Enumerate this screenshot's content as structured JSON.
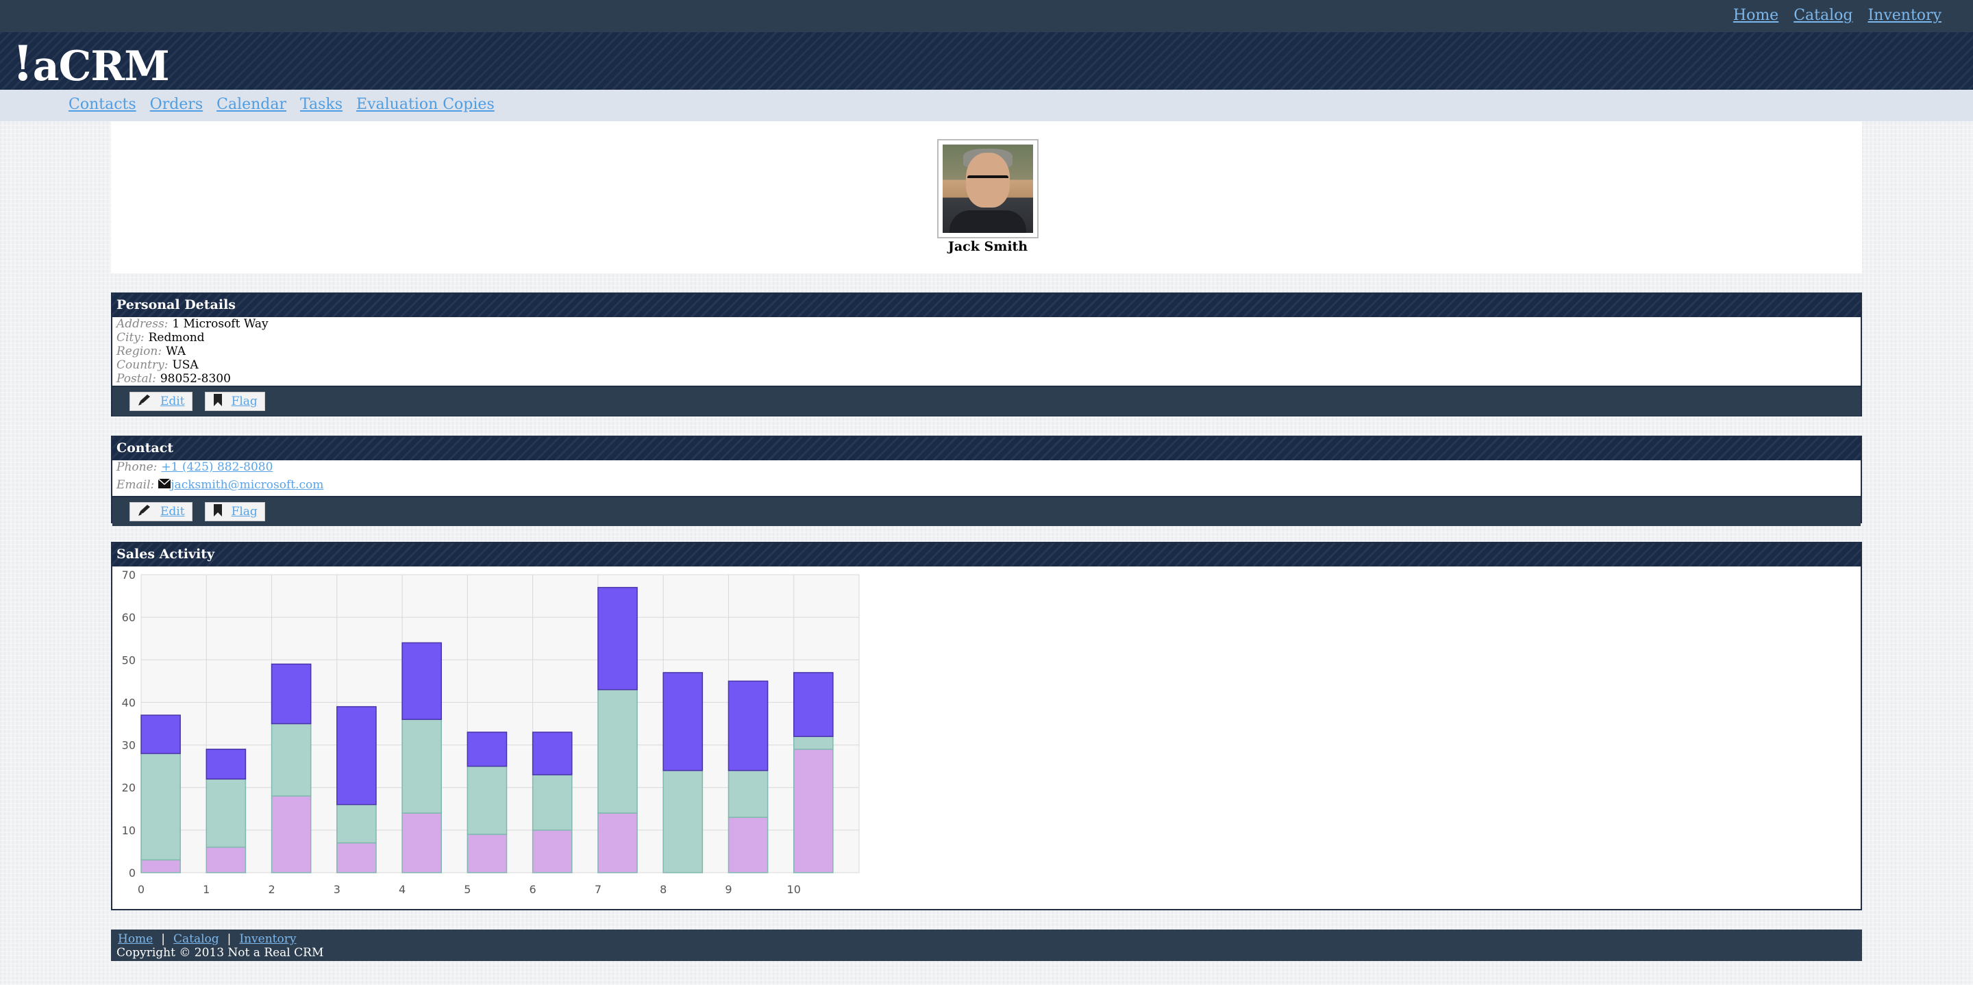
{
  "top_nav": [
    "Home",
    "Catalog",
    "Inventory"
  ],
  "brand": {
    "bang": "!",
    "name": "aCRM"
  },
  "sub_nav": [
    "Contacts",
    "Orders",
    "Calendar",
    "Tasks",
    "Evaluation Copies"
  ],
  "profile": {
    "name": "Jack Smith",
    "photo_icon": "person-photo"
  },
  "personal": {
    "title": "Personal Details",
    "fields": [
      {
        "label": "Address:",
        "value": "1 Microsoft Way"
      },
      {
        "label": "City:",
        "value": "Redmond"
      },
      {
        "label": "Region:",
        "value": "WA"
      },
      {
        "label": "Country:",
        "value": "USA"
      },
      {
        "label": "Postal:",
        "value": "98052-8300"
      }
    ],
    "edit_label": "Edit",
    "flag_label": "Flag"
  },
  "contact": {
    "title": "Contact",
    "phone_label": "Phone:",
    "phone": "+1 (425) 882-8080",
    "email_label": "Email:",
    "email": "jacksmith@microsoft.com",
    "edit_label": "Edit",
    "flag_label": "Flag"
  },
  "sales": {
    "title": "Sales Activity"
  },
  "chart_data": {
    "type": "bar",
    "stacked": true,
    "x": [
      0,
      1,
      2,
      3,
      4,
      5,
      6,
      7,
      8,
      9,
      10
    ],
    "ylim": [
      0,
      70
    ],
    "yticks": [
      0,
      10,
      20,
      30,
      40,
      50,
      60,
      70
    ],
    "grid": true,
    "series": [
      {
        "values": [
          3,
          6,
          18,
          7,
          14,
          9,
          10,
          14,
          0,
          13,
          29
        ],
        "color": "#d6aae8"
      },
      {
        "values": [
          25,
          16,
          17,
          9,
          22,
          16,
          13,
          29,
          24,
          11,
          3
        ],
        "color": "#acd3cb"
      },
      {
        "values": [
          9,
          7,
          14,
          23,
          18,
          8,
          10,
          24,
          23,
          21,
          15
        ],
        "color": "#7357f4"
      }
    ]
  },
  "footer": {
    "links": [
      "Home",
      "Catalog",
      "Inventory"
    ],
    "copyright": "Copyright © 2013 Not a Real CRM"
  }
}
